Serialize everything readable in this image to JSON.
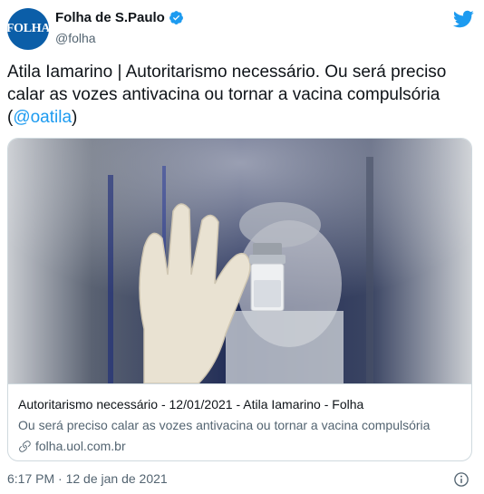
{
  "account": {
    "avatar_text": "FOLHA",
    "display_name": "Folha de S.Paulo",
    "handle": "@folha",
    "brand_color": "#0b5ea8",
    "verified_icon": "verified-badge-icon"
  },
  "tweet": {
    "text": "Atila Iamarino | Autoritarismo necessário. Ou será preciso calar as vozes antivacina ou tornar a vacina compulsória (",
    "mention": "@oatila",
    "text_end": ")",
    "mention_color": "#1d9bf0"
  },
  "card": {
    "image_icon": "vaccine-vial-photo",
    "title": "Autoritarismo necessário - 12/01/2021 - Atila Iamarino - Folha",
    "description": "Ou será preciso calar as vozes antivacina ou tornar a vacina compulsória",
    "domain": "folha.uol.com.br"
  },
  "footer": {
    "timestamp": "6:17 PM · 12 de jan de 2021"
  },
  "icons": {
    "brand": "twitter-bird-icon",
    "link": "link-icon",
    "info": "info-icon"
  },
  "colors": {
    "twitter_blue": "#1d9bf0",
    "secondary_text": "#536471",
    "border": "#cfd9de"
  }
}
